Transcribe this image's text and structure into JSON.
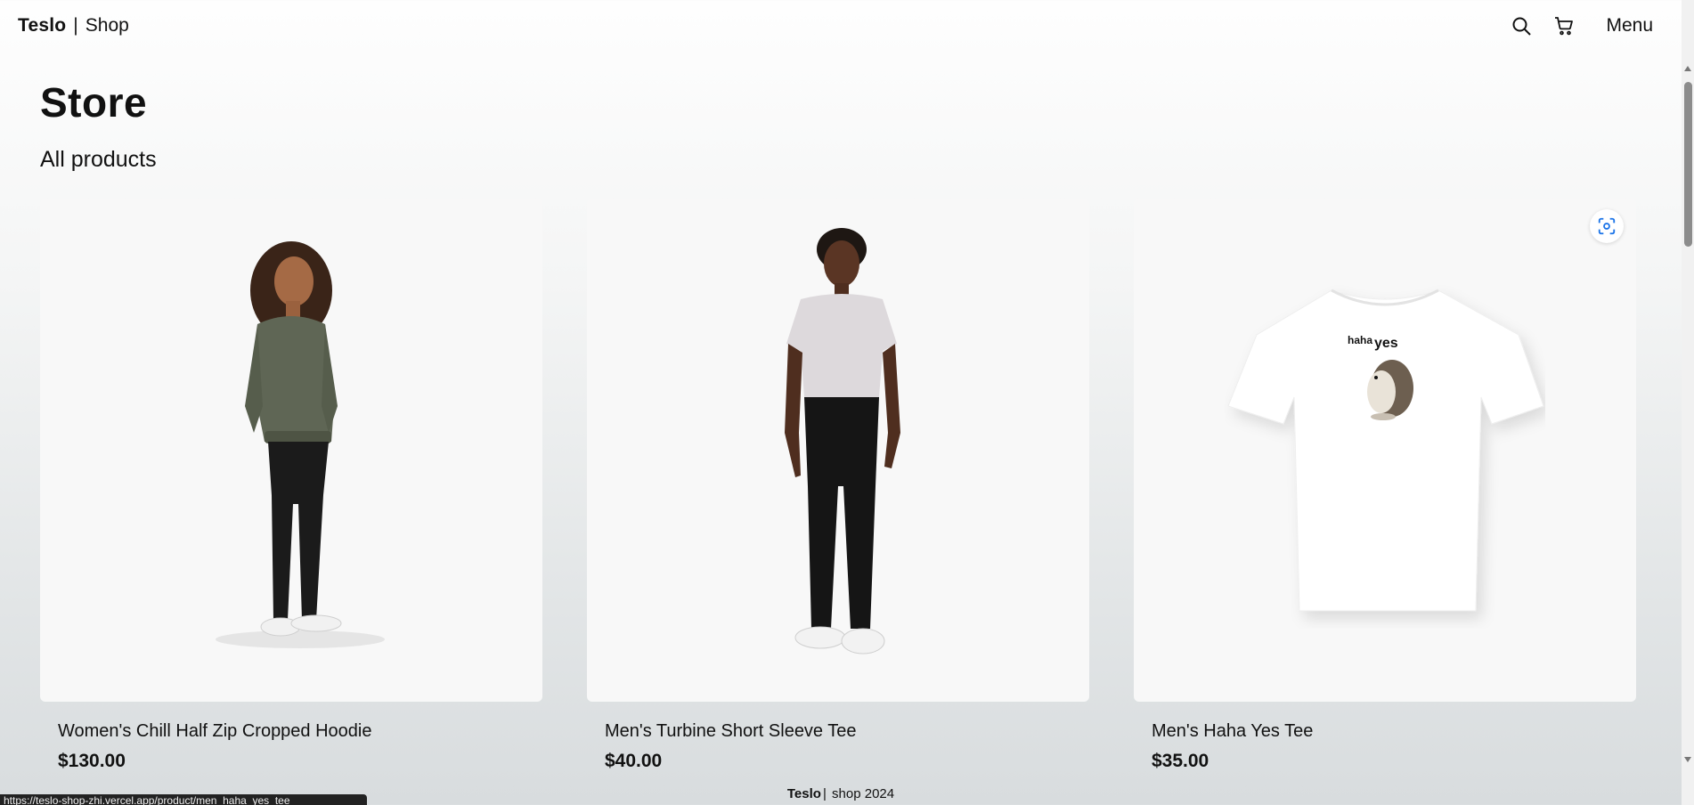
{
  "header": {
    "brand_bold": "Teslo",
    "brand_separator": "|",
    "brand_light": "Shop",
    "icons": [
      "search-icon",
      "cart-icon"
    ],
    "menu_label": "Menu"
  },
  "main": {
    "title": "Store",
    "subtitle": "All products",
    "products": [
      {
        "title": "Women's Chill Half Zip Cropped Hoodie",
        "price": "$130.00",
        "image": "woman-hoodie-model"
      },
      {
        "title": "Men's Turbine Short Sleeve Tee",
        "price": "$40.00",
        "image": "man-tee-model"
      },
      {
        "title": "Men's Haha Yes Tee",
        "price": "$35.00",
        "image": "haha-yes-tee",
        "print_small": "haha",
        "print_large": "yes"
      }
    ]
  },
  "footer": {
    "brand_bold": "Teslo",
    "separator": "|",
    "text": "shop 2024"
  },
  "statusbar": {
    "url": "https://teslo-shop-zhi.vercel.app/product/men_haha_yes_tee"
  },
  "colors": {
    "card_bg": "#f8f8f8",
    "accent_icon": "#1a73e8"
  }
}
